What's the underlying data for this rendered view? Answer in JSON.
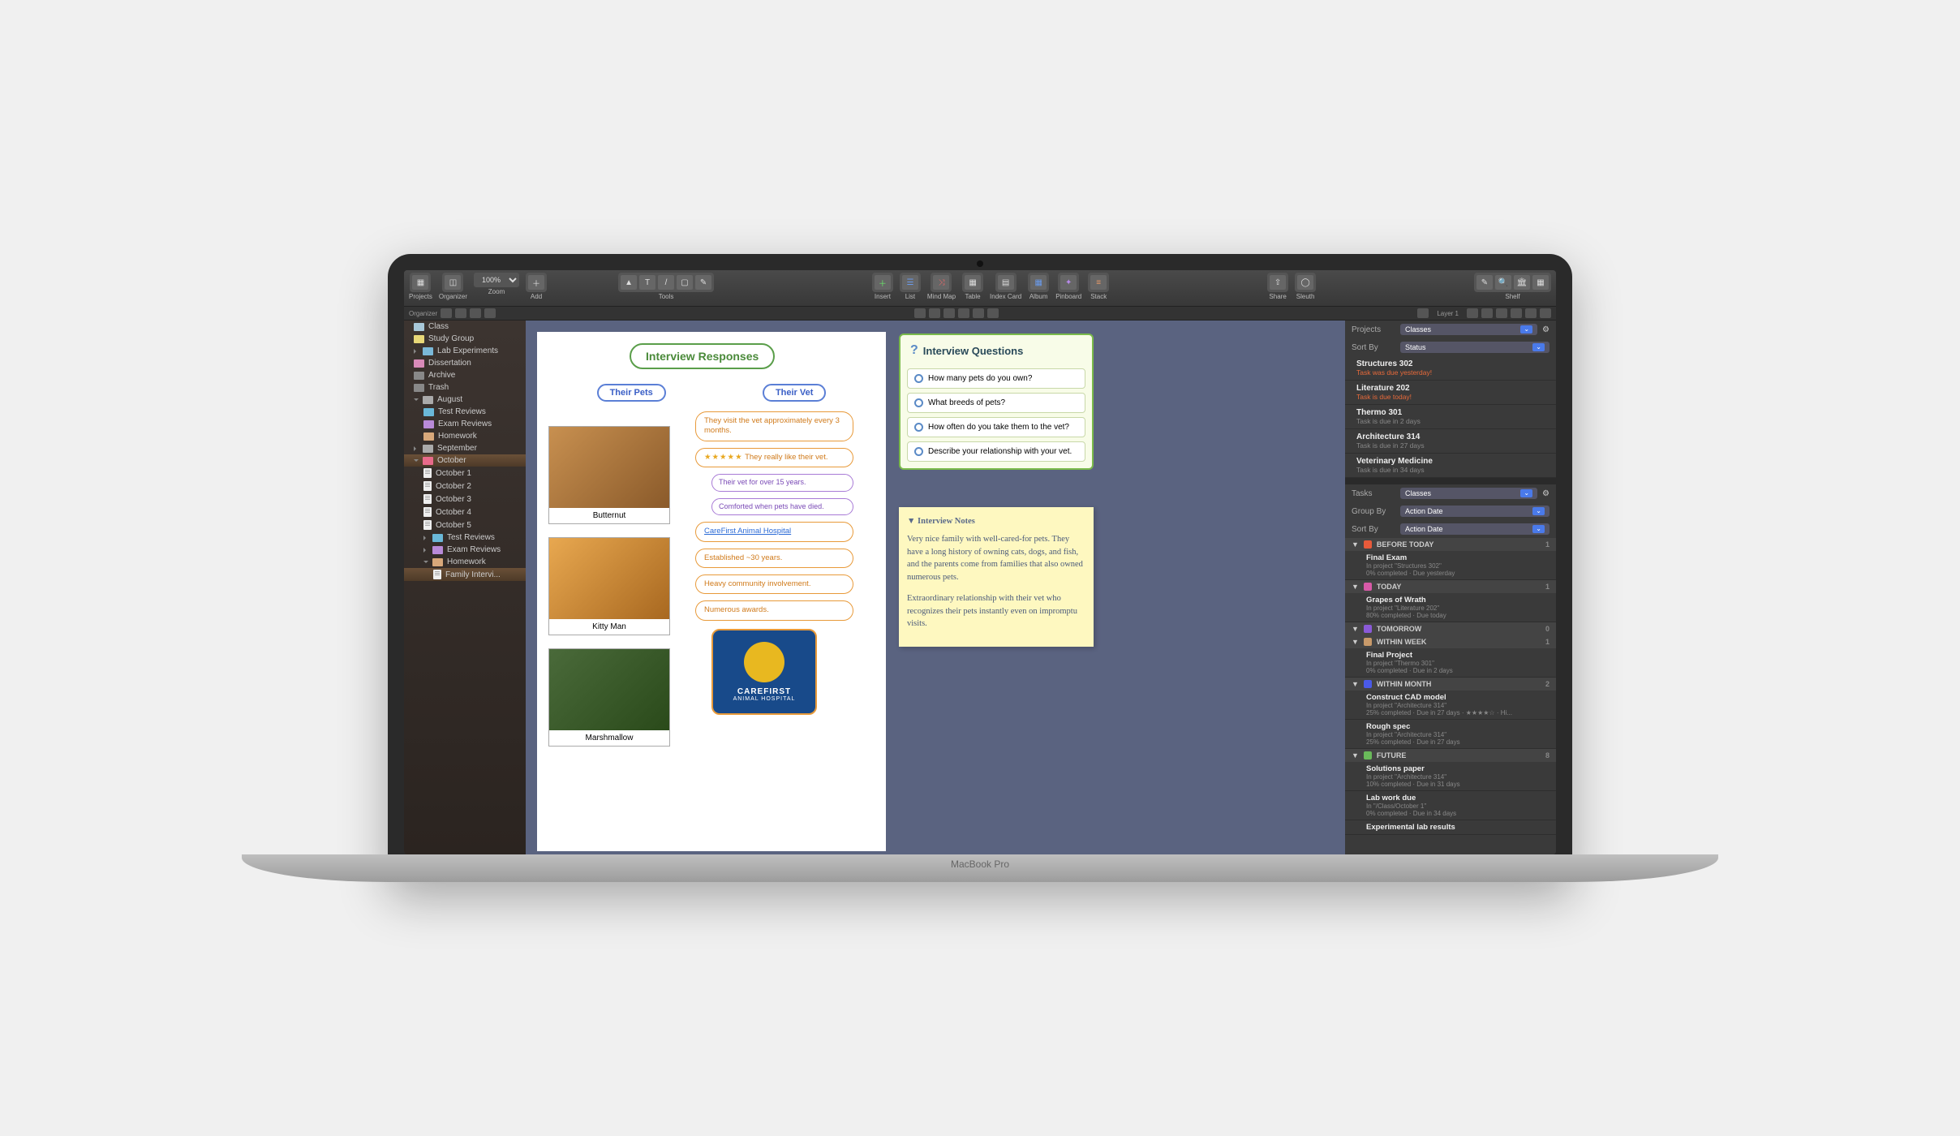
{
  "toolbar": {
    "projects": "Projects",
    "organizer": "Organizer",
    "zoom": "Zoom",
    "zoom_val": "100%",
    "add": "Add",
    "tools": "Tools",
    "insert": "Insert",
    "list": "List",
    "mindmap": "Mind Map",
    "table": "Table",
    "indexcard": "Index Card",
    "album": "Album",
    "pinboard": "Pinboard",
    "stack": "Stack",
    "share": "Share",
    "sleuth": "Sleuth",
    "shelf": "Shelf"
  },
  "viewbar": {
    "organizer": "Organizer",
    "layer": "Layer 1"
  },
  "sidebar": {
    "top": [
      {
        "label": "Class",
        "color": "#a8c8d8"
      },
      {
        "label": "Study Group",
        "color": "#e8d878"
      },
      {
        "label": "Lab Experiments",
        "color": "#7ab8d8",
        "arrow": true
      },
      {
        "label": "Dissertation",
        "color": "#d88ab8"
      },
      {
        "label": "Archive",
        "color": "#888"
      },
      {
        "label": "Trash",
        "color": "#888"
      }
    ],
    "months": [
      {
        "name": "August",
        "open": true,
        "children": [
          {
            "label": "Test Reviews",
            "color": "#6ab8d8"
          },
          {
            "label": "Exam Reviews",
            "color": "#b88ad8"
          },
          {
            "label": "Homework",
            "color": "#d8a87a"
          }
        ]
      },
      {
        "name": "September",
        "open": false,
        "children": []
      },
      {
        "name": "October",
        "open": true,
        "sel": true,
        "children": [
          {
            "label": "October 1",
            "doc": true
          },
          {
            "label": "October 2",
            "doc": true
          },
          {
            "label": "October 3",
            "doc": true
          },
          {
            "label": "October 4",
            "doc": true
          },
          {
            "label": "October 5",
            "doc": true
          },
          {
            "label": "Test Reviews",
            "color": "#6ab8d8",
            "arrow": true
          },
          {
            "label": "Exam Reviews",
            "color": "#b88ad8",
            "arrow": true
          },
          {
            "label": "Homework",
            "color": "#d8a87a",
            "arrow": true,
            "open": true
          },
          {
            "label": "Family Intervi...",
            "doc": true,
            "lvl": 2,
            "sel": true
          }
        ]
      }
    ]
  },
  "mindmap": {
    "root": "Interview Responses",
    "branches": [
      "Their Pets",
      "Their Vet"
    ],
    "pets": [
      "Butternut",
      "Kitty Man",
      "Marshmallow"
    ],
    "vet": [
      {
        "text": "They visit the vet approximately every 3 months.",
        "cls": "b-orange"
      },
      {
        "stars": "★★★★★",
        "text": "They really like their vet.",
        "cls": "b-orange"
      },
      {
        "text": "Their vet for over 15 years.",
        "cls": "b-purple"
      },
      {
        "text": "Comforted when pets have died.",
        "cls": "b-purple"
      },
      {
        "text": "CareFirst Animal Hospital",
        "cls": "b-orange b-link"
      },
      {
        "text": "Established ~30 years.",
        "cls": "b-orange"
      },
      {
        "text": "Heavy community involvement.",
        "cls": "b-orange"
      },
      {
        "text": "Numerous awards.",
        "cls": "b-orange"
      }
    ],
    "logo": {
      "name": "CAREFIRST",
      "sub": "ANIMAL HOSPITAL"
    }
  },
  "questions": {
    "title": "Interview Questions",
    "items": [
      "How many pets do you own?",
      "What breeds of pets?",
      "How often do you take them to the vet?",
      "Describe your relationship with your vet."
    ]
  },
  "notes": {
    "title": "▼ Interview Notes",
    "p1": "Very nice family with well-cared-for pets. They have a long history of owning cats, dogs, and fish, and the parents come from families that also owned numerous pets.",
    "p2": "Extraordinary relationship with their vet who recognizes their pets instantly even on impromptu visits."
  },
  "rpanel": {
    "projects_lbl": "Projects",
    "projects_val": "Classes",
    "sortby_lbl": "Sort By",
    "sortby_val": "Status",
    "projects": [
      {
        "name": "Structures 302",
        "sub": "Task was due yesterday!",
        "warn": true
      },
      {
        "name": "Literature 202",
        "sub": "Task is due today!",
        "warn": true
      },
      {
        "name": "Thermo 301",
        "sub": "Task is due in 2 days"
      },
      {
        "name": "Architecture 314",
        "sub": "Task is due in 27 days"
      },
      {
        "name": "Veterinary Medicine",
        "sub": "Task is due in 34 days"
      }
    ],
    "tasks_lbl": "Tasks",
    "tasks_val": "Classes",
    "groupby_lbl": "Group By",
    "groupby_val": "Action Date",
    "sortby2_lbl": "Sort By",
    "sortby2_val": "Action Date",
    "groups": [
      {
        "hdr": "BEFORE TODAY",
        "color": "#e85a3a",
        "cnt": "1",
        "items": [
          {
            "name": "Final Exam",
            "sub": "In project \"Structures 302\"",
            "sub2": "0% completed · Due yesterday"
          }
        ]
      },
      {
        "hdr": "TODAY",
        "color": "#d85aa8",
        "cnt": "1",
        "items": [
          {
            "name": "Grapes of Wrath",
            "sub": "In project \"Literature 202\"",
            "sub2": "80% completed · Due today"
          }
        ]
      },
      {
        "hdr": "TOMORROW",
        "color": "#8a5ad8",
        "cnt": "0",
        "items": []
      },
      {
        "hdr": "WITHIN WEEK",
        "color": "#c89a6a",
        "cnt": "1",
        "items": [
          {
            "name": "Final Project",
            "sub": "In project \"Thermo 301\"",
            "sub2": "0% completed · Due in 2 days"
          }
        ]
      },
      {
        "hdr": "WITHIN MONTH",
        "color": "#4a5ae8",
        "cnt": "2",
        "items": [
          {
            "name": "Construct CAD model",
            "sub": "In project \"Architecture 314\"",
            "sub2": "25% completed · Due in 27 days · ★★★★☆ · Hi..."
          },
          {
            "name": "Rough spec",
            "sub": "In project \"Architecture 314\"",
            "sub2": "25% completed · Due in 27 days"
          }
        ]
      },
      {
        "hdr": "FUTURE",
        "color": "#6aba5a",
        "cnt": "8",
        "items": [
          {
            "name": "Solutions paper",
            "sub": "In project \"Architecture 314\"",
            "sub2": "10% completed · Due in 31 days"
          },
          {
            "name": "Lab work due",
            "sub": "In \"/Class/October 1\"",
            "sub2": "0% completed · Due in 34 days"
          },
          {
            "name": "Experimental lab results",
            "sub": "",
            "sub2": ""
          }
        ]
      }
    ]
  },
  "base": "MacBook Pro"
}
